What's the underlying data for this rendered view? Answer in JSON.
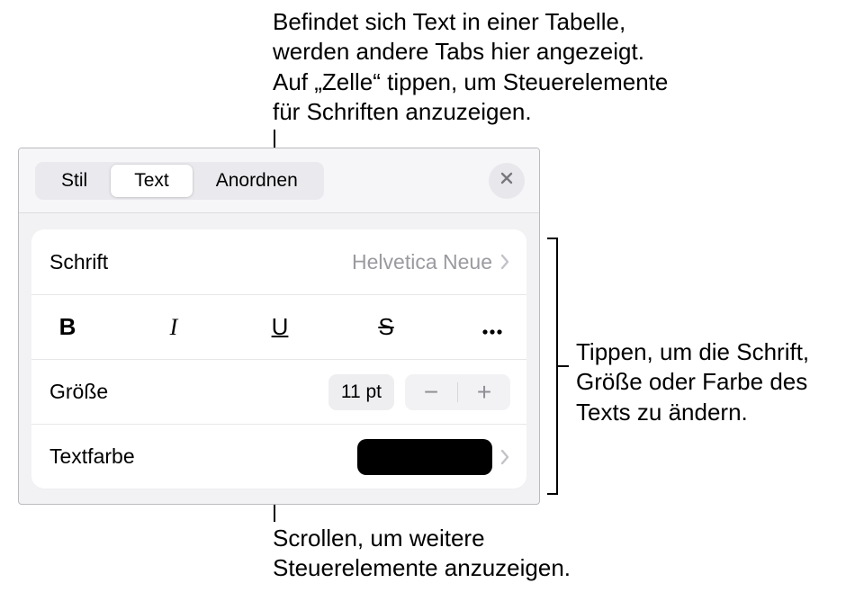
{
  "callouts": {
    "top": "Befindet sich Text in einer Tabelle,\nwerden andere Tabs hier angezeigt.\nAuf „Zelle“ tippen, um Steuerelemente\nfür Schriften anzuzeigen.",
    "right": "Tippen, um die Schrift,\nGröße oder Farbe des\nTexts zu ändern.",
    "bottom": "Scrollen, um weitere\nSteuerelemente anzuzeigen."
  },
  "tabs": {
    "stil": "Stil",
    "text": "Text",
    "anordnen": "Anordnen"
  },
  "rows": {
    "font_label": "Schrift",
    "font_value": "Helvetica Neue",
    "bold": "B",
    "italic": "I",
    "underline": "U",
    "strike": "S",
    "size_label": "Größe",
    "size_value": "11 pt",
    "minus": "−",
    "plus": "+",
    "color_label": "Textfarbe"
  },
  "colors": {
    "swatch": "#000000"
  }
}
